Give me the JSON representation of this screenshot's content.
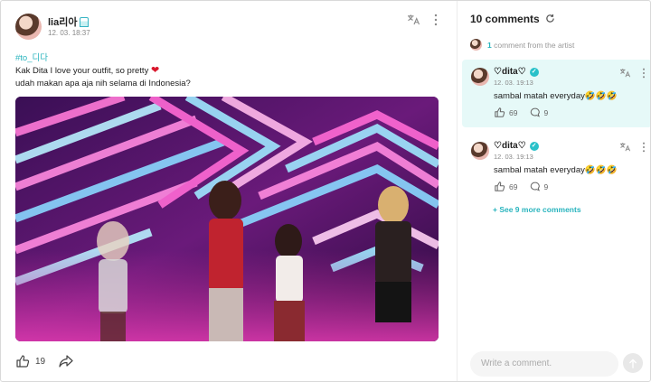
{
  "post": {
    "author": "lia리아",
    "time": "12. 03. 18:37",
    "hashtag": "#to_디다",
    "line1": "Kak Dita I love your outfit, so pretty",
    "line1_emoji": "❤",
    "line2": "udah makan apa aja nih selama di Indonesia?",
    "like_count": "19",
    "icons": {
      "translate": "translate-icon",
      "more": "more-icon",
      "like": "like-hand-icon",
      "share": "share-arrow-icon"
    }
  },
  "comments_panel": {
    "title": "10 comments",
    "artist_strip": {
      "count": "1",
      "label": "comment from the artist"
    },
    "comments": [
      {
        "name": "♡dita♡",
        "time": "12. 03. 19:13",
        "text": "sambal matah everyday🤣🤣🤣",
        "likes": "69",
        "replies": "9",
        "highlighted": true
      },
      {
        "name": "♡dita♡",
        "time": "12. 03. 19:13",
        "text": "sambal matah everyday🤣🤣🤣",
        "likes": "69",
        "replies": "9",
        "highlighted": false
      }
    ],
    "see_more": "+ See 9 more comments",
    "input_placeholder": "Write a comment."
  },
  "colors": {
    "accent": "#29b4be",
    "highlight_bg": "#e6f9f8",
    "heart": "#d9172c"
  }
}
